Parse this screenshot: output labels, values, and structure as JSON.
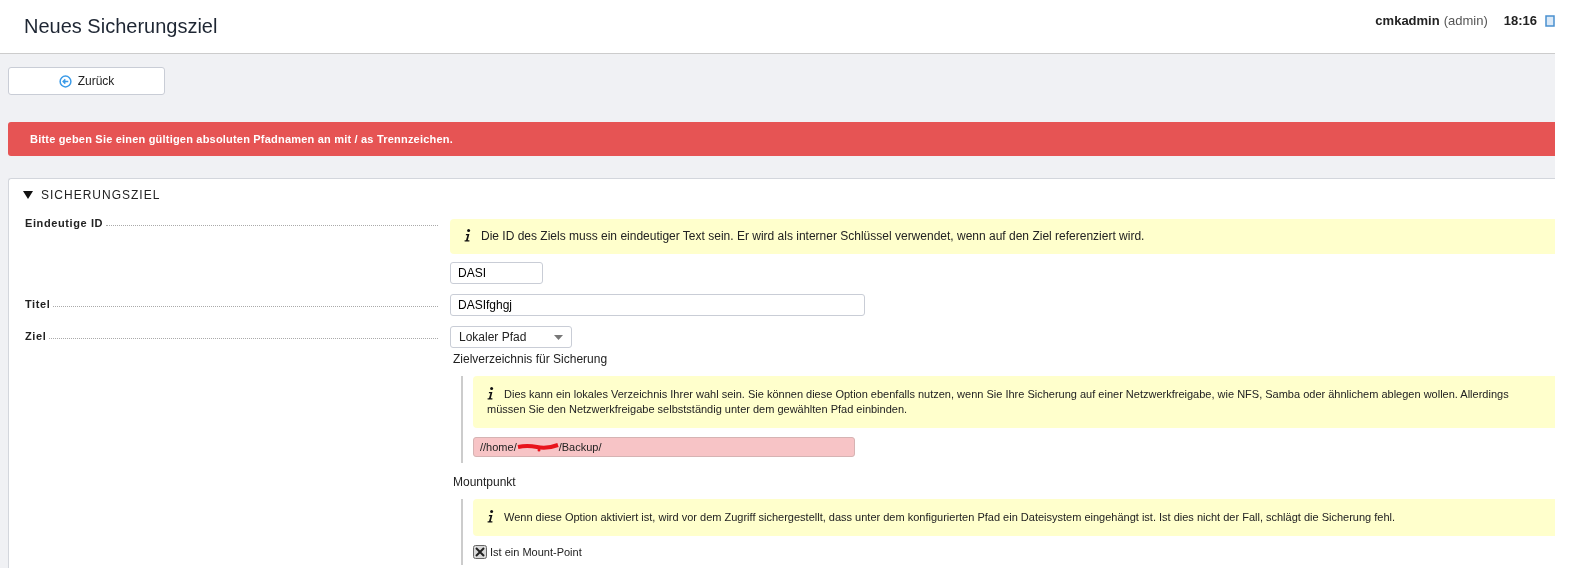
{
  "header": {
    "title": "Neues Sicherungsziel",
    "user": "cmkadmin",
    "role": "(admin)",
    "time": "18:16"
  },
  "back_button": {
    "label": "Zurück"
  },
  "error_message": "Bitte geben Sie einen gültigen absoluten Pfadnamen an mit / as Trennzeichen.",
  "section": {
    "title": "SICHERUNGSZIEL",
    "expanded": true,
    "rows": [
      {
        "kind": "id",
        "label": "Eindeutige ID",
        "help": "Die ID des Ziels muss ein eindeutiger Text sein. Er wird als interner Schlüssel verwendet, wenn auf den Ziel referenziert wird.",
        "value": "DASI"
      },
      {
        "kind": "text",
        "label": "Titel",
        "value": "DASIfghgj"
      },
      {
        "kind": "target",
        "label": "Ziel",
        "select": "Lokaler Pfad",
        "subsections": [
          {
            "kind": "path",
            "title": "Zielverzeichnis für Sicherung",
            "help": "Dies kann ein lokales Verzeichnis Ihrer wahl sein. Sie können diese Option ebenfalls nutzen, wenn Sie Ihre Sicherung auf einer Netzwerkfreigabe, wie NFS, Samba oder ähnlichem ablegen wollen. Allerdings müssen Sie den Netzwerkfreigabe selbstständig unter dem gewählten Pfad einbinden.",
            "value_start": "//home/",
            "value_end": "/Backup/",
            "redacted": true,
            "error": true
          },
          {
            "kind": "checkbox",
            "title": "Mountpunkt",
            "help": "Wenn diese Option aktiviert ist, wird vor dem Zugriff sichergestellt, dass unter dem konfigurierten Pfad ein Dateisystem eingehängt ist. Ist dies nicht der Fall, schlägt die Sicherung fehl.",
            "label": "Ist ein Mount-Point",
            "checked": true
          }
        ]
      }
    ]
  }
}
